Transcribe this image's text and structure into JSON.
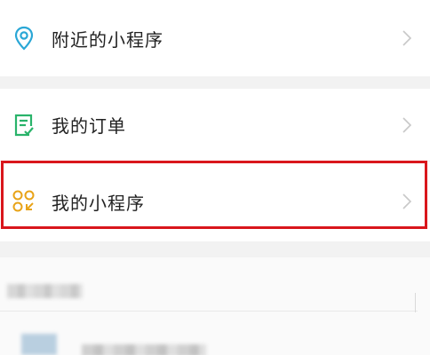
{
  "menu": {
    "nearby": {
      "label": "附近的小程序",
      "icon": "location-pin-icon",
      "icon_color": "#2aa7d6"
    },
    "orders": {
      "label": "我的订单",
      "icon": "order-checklist-icon",
      "icon_color": "#29b36a"
    },
    "mine": {
      "label": "我的小程序",
      "icon": "mini-program-grid-icon",
      "icon_color": "#e8a317"
    }
  },
  "colors": {
    "background": "#f2f2f2",
    "row_background": "#ffffff",
    "highlight_border": "#d9161c",
    "chevron": "#c8c8c8"
  }
}
